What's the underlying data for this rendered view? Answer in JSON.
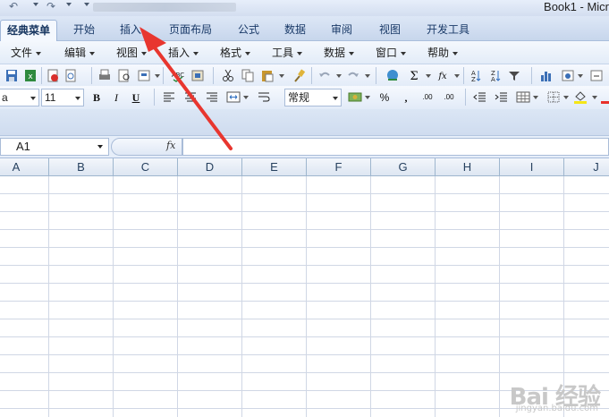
{
  "window": {
    "title": "Book1 - Micr"
  },
  "quick_access": {
    "undo": "↶",
    "redo": "↷"
  },
  "ribbon_tabs": [
    {
      "label": "经典菜单",
      "active": true
    },
    {
      "label": "开始"
    },
    {
      "label": "插入"
    },
    {
      "label": "页面布局"
    },
    {
      "label": "公式"
    },
    {
      "label": "数据"
    },
    {
      "label": "审阅"
    },
    {
      "label": "视图"
    },
    {
      "label": "开发工具"
    }
  ],
  "menu_bar": [
    "文件",
    "编辑",
    "视图",
    "插入",
    "格式",
    "工具",
    "数据",
    "窗口",
    "帮助"
  ],
  "toolbar2": {
    "font_name": "a",
    "font_size": "11",
    "bold": "B",
    "italic": "I",
    "underline": "U",
    "number_format": "常规",
    "percent": "%",
    "comma": ",",
    "inc_decimal": ".00",
    "dec_decimal": ".00"
  },
  "formula_bar": {
    "cell_ref": "A1",
    "fx": "fx",
    "formula": ""
  },
  "columns": [
    "A",
    "B",
    "C",
    "D",
    "E",
    "F",
    "G",
    "H",
    "I",
    "J"
  ],
  "watermark": {
    "brand": "Bai 经验",
    "url": "jingyan.baidu.com"
  },
  "colors": {
    "accent": "#1a3a68",
    "arrow": "#e8362f",
    "grid_line": "#d0d7e5"
  }
}
